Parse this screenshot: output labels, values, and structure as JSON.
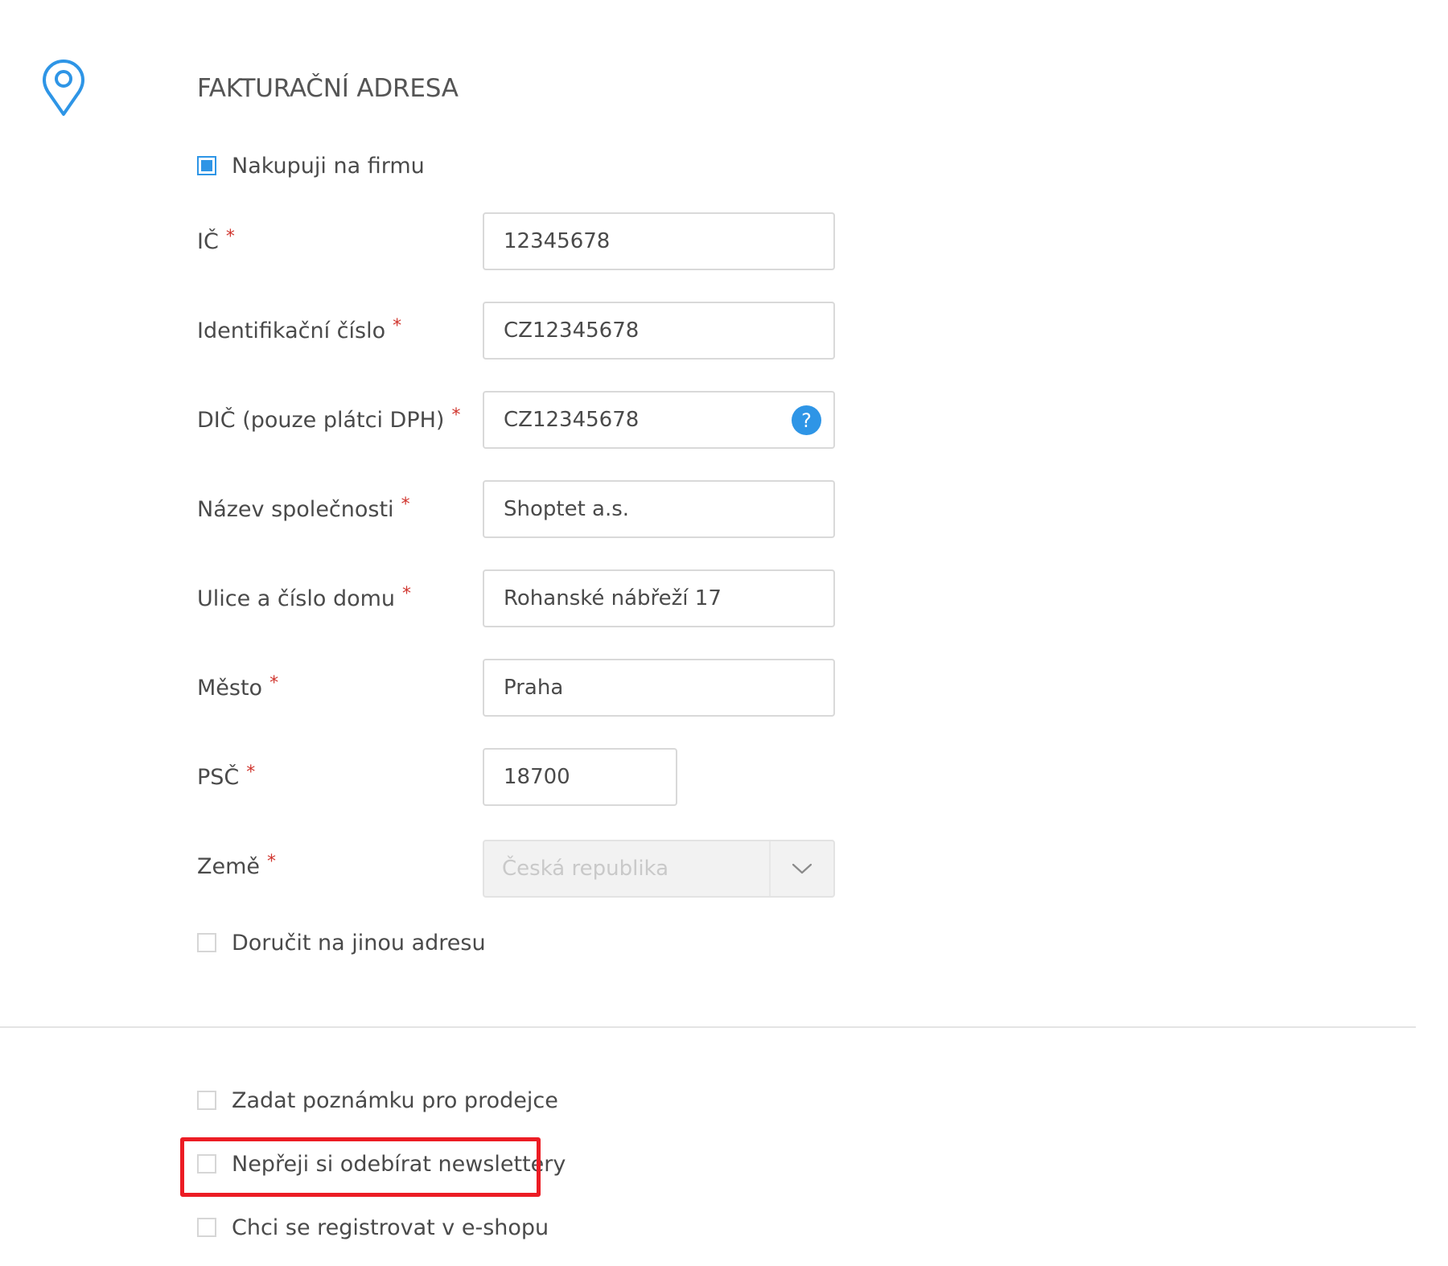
{
  "section": {
    "title": "FAKTURAČNÍ ADRESA",
    "icon": "location-pin-icon"
  },
  "company_checkbox": {
    "label": "Nakupuji na firmu",
    "checked": true
  },
  "required_mark": "*",
  "fields": {
    "ic": {
      "label": "IČ",
      "value": "12345678"
    },
    "identification": {
      "label": "Identifikační číslo",
      "value": "CZ12345678"
    },
    "dic": {
      "label": "DIČ (pouze plátci DPH)",
      "value": "CZ12345678",
      "help_glyph": "?"
    },
    "company_name": {
      "label": "Název společnosti",
      "value": "Shoptet a.s."
    },
    "street": {
      "label": "Ulice a číslo domu",
      "value": "Rohanské nábřeží 17"
    },
    "city": {
      "label": "Město",
      "value": "Praha"
    },
    "zip": {
      "label": "PSČ",
      "value": "18700"
    },
    "country": {
      "label": "Země",
      "value": "Česká republika",
      "disabled": true
    }
  },
  "other_address_checkbox": {
    "label": "Doručit na jinou adresu",
    "checked": false
  },
  "bottom_options": {
    "note": {
      "label": "Zadat poznámku pro prodejce",
      "checked": false
    },
    "newsletter": {
      "label": "Nepřeji si odebírat newslettery",
      "checked": false,
      "highlighted": true
    },
    "register": {
      "label": "Chci se registrovat v e-shopu",
      "checked": false
    }
  },
  "colors": {
    "accent": "#2e95e6",
    "required": "#d0352e",
    "highlight": "#ec1c24",
    "text": "#4a4a4a"
  }
}
